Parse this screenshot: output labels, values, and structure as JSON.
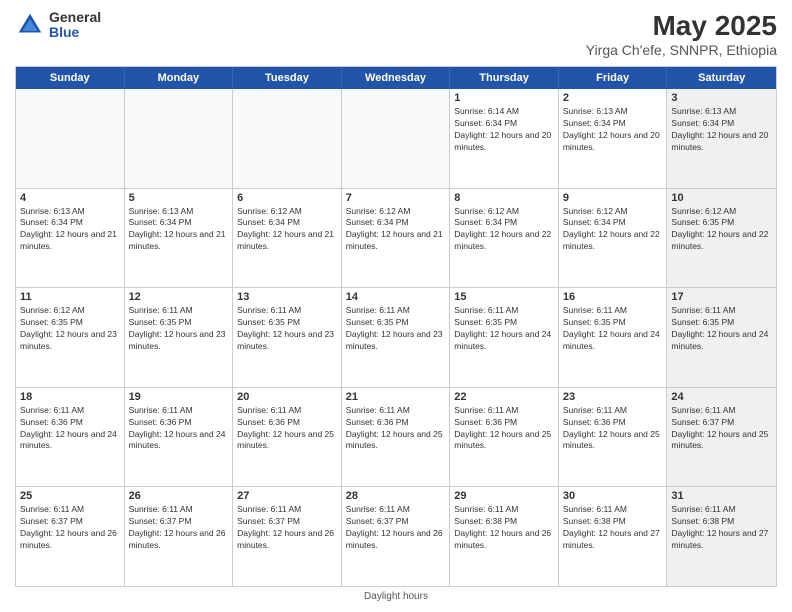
{
  "header": {
    "logo_general": "General",
    "logo_blue": "Blue",
    "main_title": "May 2025",
    "subtitle": "Yirga Ch'efe, SNNPR, Ethiopia"
  },
  "calendar": {
    "days_of_week": [
      "Sunday",
      "Monday",
      "Tuesday",
      "Wednesday",
      "Thursday",
      "Friday",
      "Saturday"
    ],
    "weeks": [
      [
        {
          "day": "",
          "info": "",
          "empty": true
        },
        {
          "day": "",
          "info": "",
          "empty": true
        },
        {
          "day": "",
          "info": "",
          "empty": true
        },
        {
          "day": "",
          "info": "",
          "empty": true
        },
        {
          "day": "1",
          "info": "Sunrise: 6:14 AM\nSunset: 6:34 PM\nDaylight: 12 hours and 20 minutes."
        },
        {
          "day": "2",
          "info": "Sunrise: 6:13 AM\nSunset: 6:34 PM\nDaylight: 12 hours and 20 minutes."
        },
        {
          "day": "3",
          "info": "Sunrise: 6:13 AM\nSunset: 6:34 PM\nDaylight: 12 hours and 20 minutes.",
          "shade": true
        }
      ],
      [
        {
          "day": "4",
          "info": "Sunrise: 6:13 AM\nSunset: 6:34 PM\nDaylight: 12 hours and 21 minutes."
        },
        {
          "day": "5",
          "info": "Sunrise: 6:13 AM\nSunset: 6:34 PM\nDaylight: 12 hours and 21 minutes."
        },
        {
          "day": "6",
          "info": "Sunrise: 6:12 AM\nSunset: 6:34 PM\nDaylight: 12 hours and 21 minutes."
        },
        {
          "day": "7",
          "info": "Sunrise: 6:12 AM\nSunset: 6:34 PM\nDaylight: 12 hours and 21 minutes."
        },
        {
          "day": "8",
          "info": "Sunrise: 6:12 AM\nSunset: 6:34 PM\nDaylight: 12 hours and 22 minutes."
        },
        {
          "day": "9",
          "info": "Sunrise: 6:12 AM\nSunset: 6:34 PM\nDaylight: 12 hours and 22 minutes."
        },
        {
          "day": "10",
          "info": "Sunrise: 6:12 AM\nSunset: 6:35 PM\nDaylight: 12 hours and 22 minutes.",
          "shade": true
        }
      ],
      [
        {
          "day": "11",
          "info": "Sunrise: 6:12 AM\nSunset: 6:35 PM\nDaylight: 12 hours and 23 minutes."
        },
        {
          "day": "12",
          "info": "Sunrise: 6:11 AM\nSunset: 6:35 PM\nDaylight: 12 hours and 23 minutes."
        },
        {
          "day": "13",
          "info": "Sunrise: 6:11 AM\nSunset: 6:35 PM\nDaylight: 12 hours and 23 minutes."
        },
        {
          "day": "14",
          "info": "Sunrise: 6:11 AM\nSunset: 6:35 PM\nDaylight: 12 hours and 23 minutes."
        },
        {
          "day": "15",
          "info": "Sunrise: 6:11 AM\nSunset: 6:35 PM\nDaylight: 12 hours and 24 minutes."
        },
        {
          "day": "16",
          "info": "Sunrise: 6:11 AM\nSunset: 6:35 PM\nDaylight: 12 hours and 24 minutes."
        },
        {
          "day": "17",
          "info": "Sunrise: 6:11 AM\nSunset: 6:35 PM\nDaylight: 12 hours and 24 minutes.",
          "shade": true
        }
      ],
      [
        {
          "day": "18",
          "info": "Sunrise: 6:11 AM\nSunset: 6:36 PM\nDaylight: 12 hours and 24 minutes."
        },
        {
          "day": "19",
          "info": "Sunrise: 6:11 AM\nSunset: 6:36 PM\nDaylight: 12 hours and 24 minutes."
        },
        {
          "day": "20",
          "info": "Sunrise: 6:11 AM\nSunset: 6:36 PM\nDaylight: 12 hours and 25 minutes."
        },
        {
          "day": "21",
          "info": "Sunrise: 6:11 AM\nSunset: 6:36 PM\nDaylight: 12 hours and 25 minutes."
        },
        {
          "day": "22",
          "info": "Sunrise: 6:11 AM\nSunset: 6:36 PM\nDaylight: 12 hours and 25 minutes."
        },
        {
          "day": "23",
          "info": "Sunrise: 6:11 AM\nSunset: 6:36 PM\nDaylight: 12 hours and 25 minutes."
        },
        {
          "day": "24",
          "info": "Sunrise: 6:11 AM\nSunset: 6:37 PM\nDaylight: 12 hours and 25 minutes.",
          "shade": true
        }
      ],
      [
        {
          "day": "25",
          "info": "Sunrise: 6:11 AM\nSunset: 6:37 PM\nDaylight: 12 hours and 26 minutes."
        },
        {
          "day": "26",
          "info": "Sunrise: 6:11 AM\nSunset: 6:37 PM\nDaylight: 12 hours and 26 minutes."
        },
        {
          "day": "27",
          "info": "Sunrise: 6:11 AM\nSunset: 6:37 PM\nDaylight: 12 hours and 26 minutes."
        },
        {
          "day": "28",
          "info": "Sunrise: 6:11 AM\nSunset: 6:37 PM\nDaylight: 12 hours and 26 minutes."
        },
        {
          "day": "29",
          "info": "Sunrise: 6:11 AM\nSunset: 6:38 PM\nDaylight: 12 hours and 26 minutes."
        },
        {
          "day": "30",
          "info": "Sunrise: 6:11 AM\nSunset: 6:38 PM\nDaylight: 12 hours and 27 minutes."
        },
        {
          "day": "31",
          "info": "Sunrise: 6:11 AM\nSunset: 6:38 PM\nDaylight: 12 hours and 27 minutes.",
          "shade": true
        }
      ]
    ]
  },
  "footer": {
    "text": "Daylight hours"
  }
}
